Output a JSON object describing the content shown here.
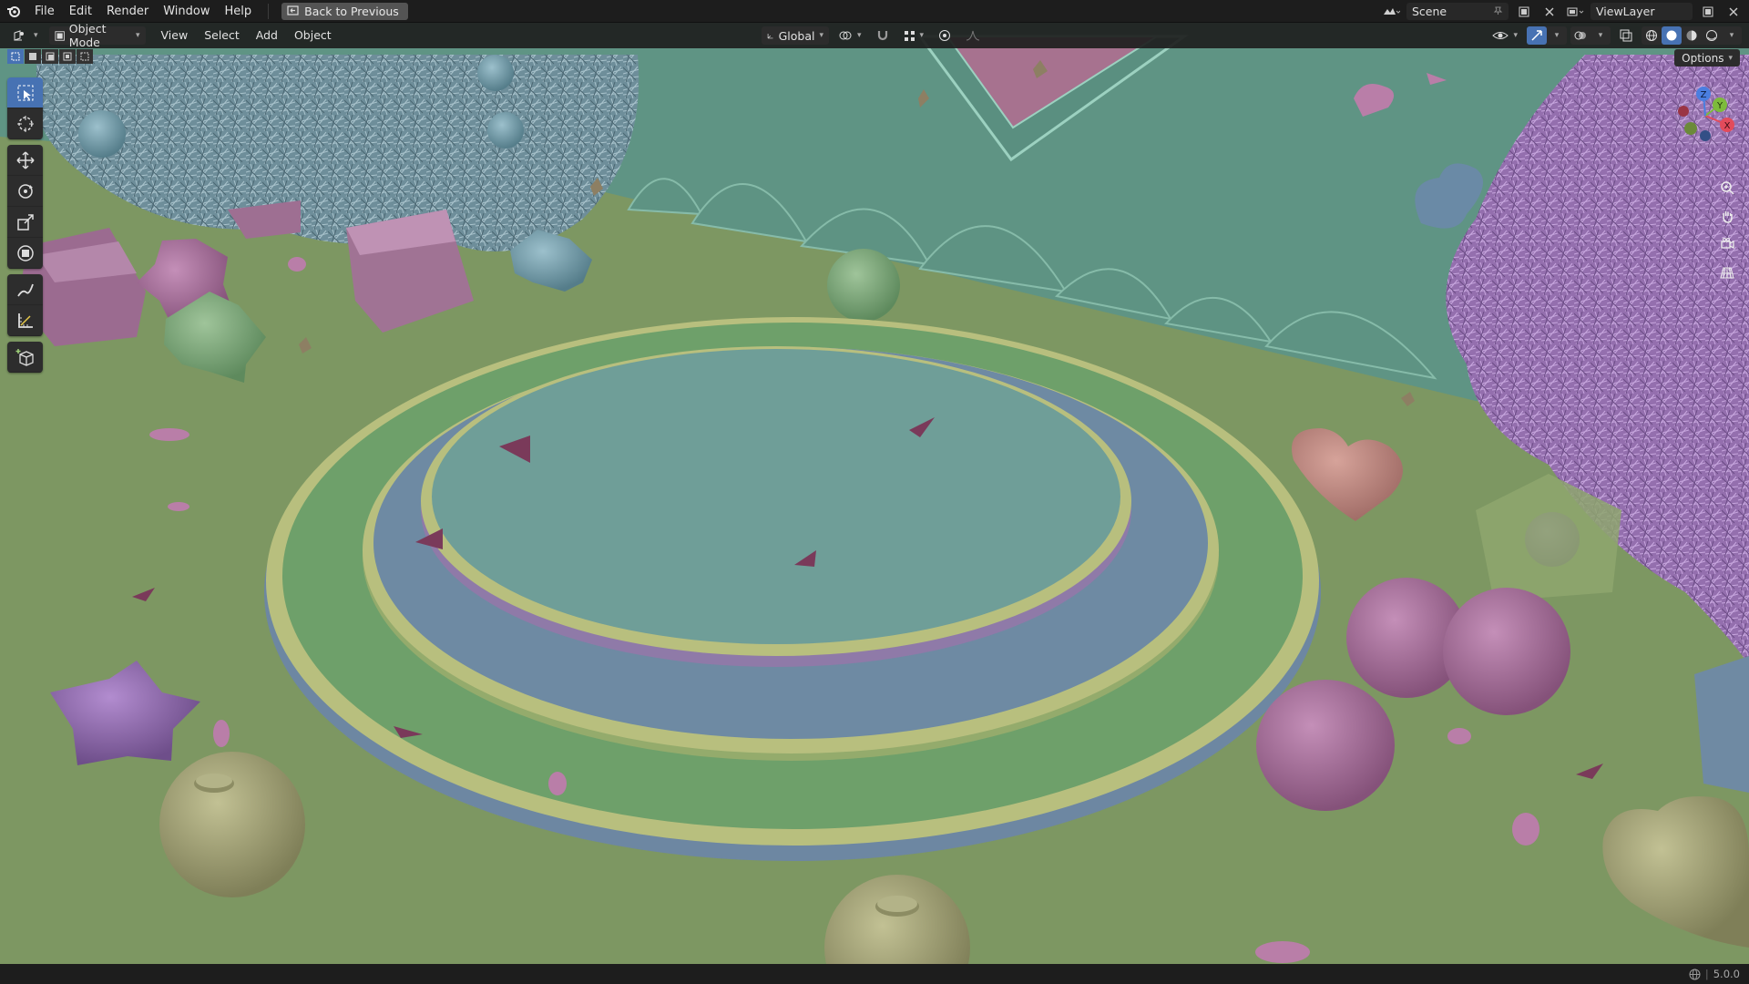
{
  "menubar": {
    "items": [
      "File",
      "Edit",
      "Render",
      "Window",
      "Help"
    ],
    "back_button": "Back to Previous"
  },
  "topright": {
    "scene_label": "Scene",
    "viewlayer_label": "ViewLayer"
  },
  "viewport_header": {
    "mode_label": "Object Mode",
    "menus": [
      "View",
      "Select",
      "Add",
      "Object"
    ],
    "orientation_label": "Global",
    "options_label": "Options"
  },
  "toolbar": {
    "tools": [
      "select-box",
      "cursor",
      "move",
      "rotate",
      "scale",
      "transform",
      "annotate",
      "measure",
      "add-cube"
    ],
    "active_tool": "select-box"
  },
  "gizmo": {
    "axes": [
      "X",
      "Y",
      "Z"
    ]
  },
  "statusbar": {
    "version": "5.0.0"
  },
  "colors": {
    "accent": "#4772b3",
    "ui_bg": "#1d1d1d",
    "floor": "#7d9762",
    "wall": "#5f9484",
    "stage_top": "#6f9e98",
    "stage_blue": "#6e8aa3",
    "stage_green": "#6ea06a",
    "rim_yellow": "#b8bf7e",
    "pink": "#a86f9c",
    "purple_tree": "#9b7ab8",
    "blue_tree": "#6f8e9e",
    "olive": "#a7a77a"
  }
}
